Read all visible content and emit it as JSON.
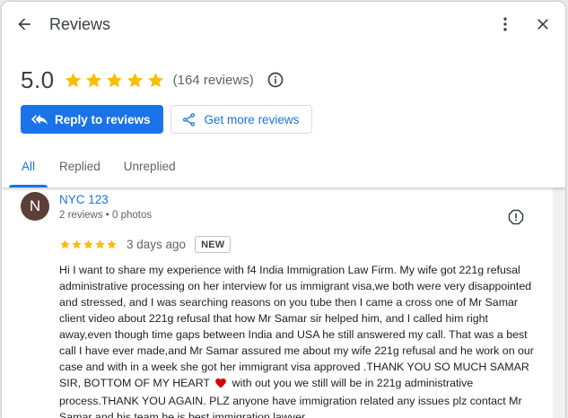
{
  "header": {
    "title": "Reviews",
    "rating": "5.0",
    "stars": 5,
    "review_count": "(164 reviews)"
  },
  "actions": {
    "reply_label": "Reply to reviews",
    "more_label": "Get more reviews"
  },
  "tabs": [
    {
      "label": "All",
      "active": true
    },
    {
      "label": "Replied",
      "active": false
    },
    {
      "label": "Unreplied",
      "active": false
    }
  ],
  "review": {
    "avatar_initial": "N",
    "avatar_color": "#5b4038",
    "name": "NYC 123",
    "meta": "2 reviews • 0 photos",
    "stars": 5,
    "date": "3 days ago",
    "badge": "NEW",
    "text_before_heart": "Hi I want to share my experience with f4 India Immigration Law Firm. My wife got 221g refusal administrative processing on her interview for us immigrant visa,we both were very disappointed and stressed, and I was searching reasons on you tube then I came a cross one of Mr Samar client video about 221g refusal that how Mr Samar sir helped him, and I called him right away,even though time gaps between India and USA he still answered my call. That was a best call I have ever made,and Mr Samar assured me about my wife 221g refusal and he work on our case and with in a week she got her immigrant visa approved .THANK YOU SO MUCH SAMAR SIR, BOTTOM OF MY HEART",
    "text_after_heart": " with out you we still will be in 221g administrative process.THANK YOU AGAIN. PLZ anyone have immigration related any issues plz contact Mr Samar and his team,he is best immigration lawyer."
  },
  "colors": {
    "accent": "#1a73e8",
    "star": "#fbbc04",
    "heart": "#d50000"
  }
}
